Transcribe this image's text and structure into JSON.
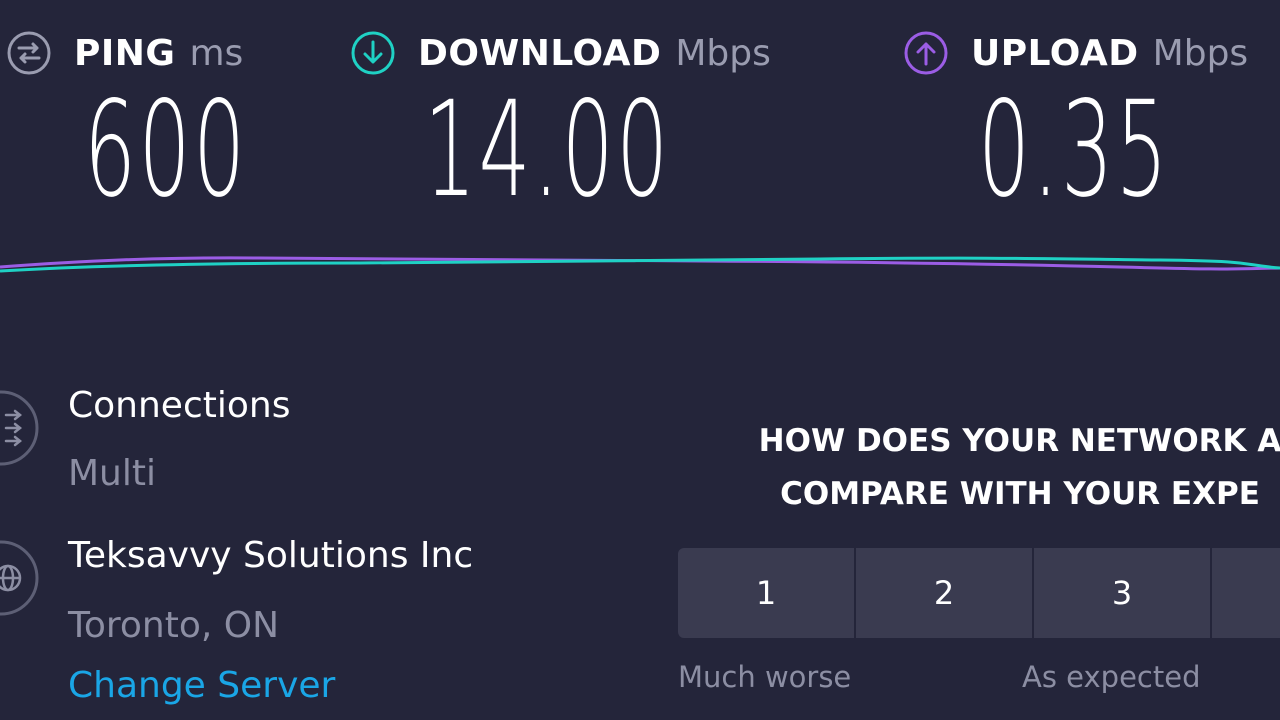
{
  "metrics": {
    "ping": {
      "label": "PING",
      "unit": "ms",
      "value": "600",
      "icon": "ping-icon",
      "color": "#9a9cb0"
    },
    "download": {
      "label": "DOWNLOAD",
      "unit": "Mbps",
      "value": "14.00",
      "icon": "download-arrow-icon",
      "color": "#1fd1c4"
    },
    "upload": {
      "label": "UPLOAD",
      "unit": "Mbps",
      "value": "0.35",
      "icon": "upload-arrow-icon",
      "color": "#9b5de5"
    }
  },
  "graph": {
    "download_color": "#1fd1c4",
    "upload_color": "#9b5de5"
  },
  "server_info": {
    "connections": {
      "title": "Connections",
      "value": "Multi",
      "icon": "connections-icon"
    },
    "server": {
      "name": "Teksavvy Solutions Inc",
      "location": "Toronto, ON",
      "icon": "globe-icon"
    },
    "change_server_label": "Change Server"
  },
  "survey": {
    "question_line1": "HOW DOES YOUR NETWORK A",
    "question_line2": "COMPARE WITH YOUR EXPE",
    "ratings": [
      "1",
      "2",
      "3",
      ""
    ],
    "caption_low": "Much worse",
    "caption_mid": "As expected"
  },
  "colors": {
    "background": "#24253a",
    "accent_link": "#1aa6e6",
    "button_bg": "#3a3b50",
    "muted_text": "#8c8ea3"
  }
}
